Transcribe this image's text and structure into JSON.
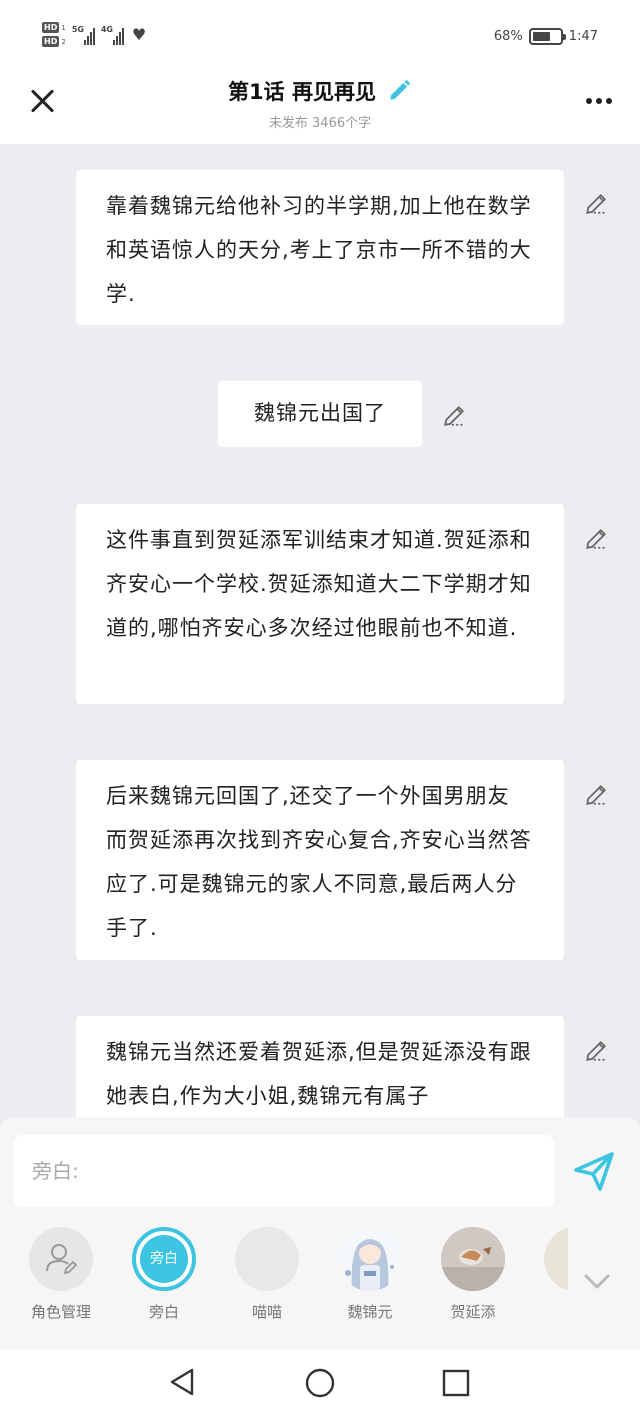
{
  "status_bar": {
    "hd1_label": "HD",
    "hd1_num": "1",
    "hd2_label": "HD",
    "hd2_num": "2",
    "net1": "5G",
    "net2": "4G",
    "battery_pct": "68%",
    "battery_level": 0.68,
    "time": "1:47"
  },
  "header": {
    "title": "第1话 再见再见",
    "subtitle": "未发布 3466个字",
    "accent_color": "#3cc5e0"
  },
  "cards": [
    "靠着魏锦元给他补习的半学期,加上他在数学和英语惊人的天分,考上了京市一所不错的大学.",
    "魏锦元出国了",
    "这件事直到贺延添军训结束才知道.贺延添和齐安心一个学校.贺延添知道大二下学期才知道的,哪怕齐安心多次经过他眼前也不知道.",
    "后来魏锦元回国了,还交了一个外国男朋友 而贺延添再次找到齐安心复合,齐安心当然答应了.可是魏锦元的家人不同意,最后两人分手了.",
    "魏锦元当然还爱着贺延添,但是贺延添没有跟她表白,作为大小姐,魏锦元有属子"
  ],
  "composer": {
    "placeholder": "旁白:",
    "send_color": "#3cc5e0"
  },
  "roles": [
    {
      "label": "角色管理",
      "icon": "person-edit-icon"
    },
    {
      "label": "旁白",
      "avatar_text": "旁白"
    },
    {
      "label": "喵喵"
    },
    {
      "label": "魏锦元"
    },
    {
      "label": "贺延添"
    }
  ]
}
